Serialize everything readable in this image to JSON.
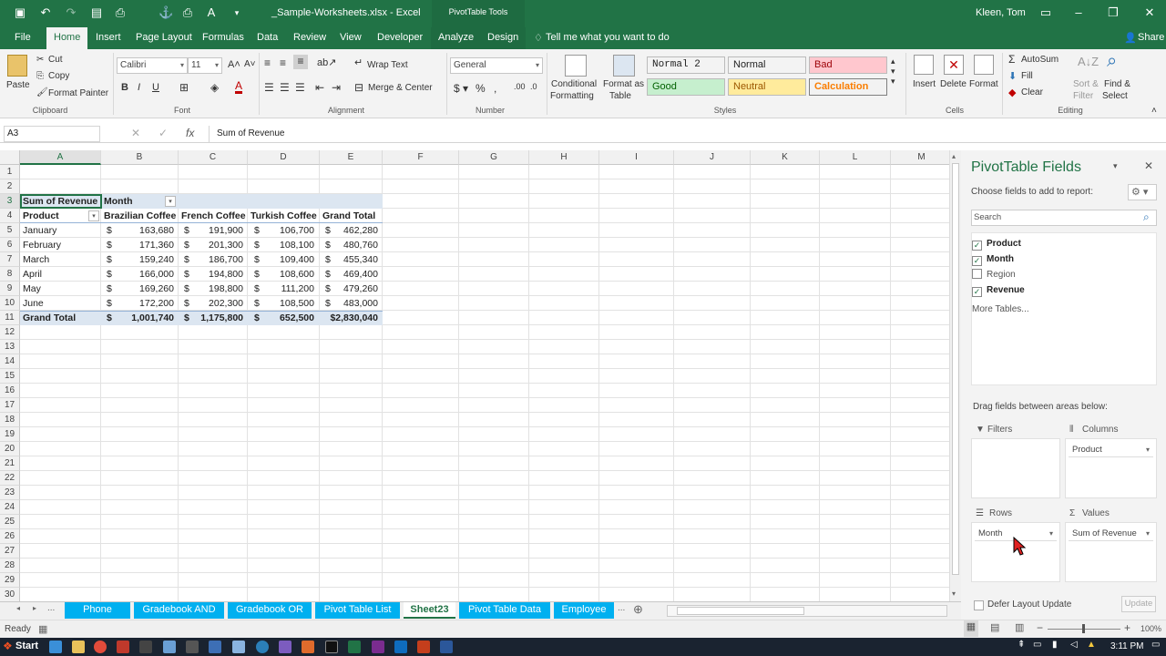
{
  "window": {
    "title": "_Sample-Worksheets.xlsx  -  Excel",
    "context_tab": "PivotTable Tools",
    "user": "Kleen, Tom",
    "share": "Share"
  },
  "tabs": [
    "File",
    "Home",
    "Insert",
    "Page Layout",
    "Formulas",
    "Data",
    "Review",
    "View",
    "Developer",
    "Analyze",
    "Design"
  ],
  "tell_me": "Tell me what you want to do",
  "ribbon": {
    "clipboard": {
      "label": "Clipboard",
      "paste": "Paste",
      "cut": "Cut",
      "copy": "Copy",
      "format_painter": "Format Painter"
    },
    "font": {
      "label": "Font",
      "name": "Calibri",
      "size": "11"
    },
    "alignment": {
      "label": "Alignment",
      "wrap": "Wrap Text",
      "merge": "Merge & Center"
    },
    "number": {
      "label": "Number",
      "format": "General"
    },
    "styles": {
      "label": "Styles",
      "conditional": "Conditional",
      "formatting": "Formatting",
      "format_as": "Format as",
      "table": "Table",
      "items": [
        {
          "name": "Normal 2",
          "bg": "#ffffff",
          "fg": "#333333"
        },
        {
          "name": "Normal",
          "bg": "#ffffff",
          "fg": "#000000"
        },
        {
          "name": "Bad",
          "bg": "#ffc7ce",
          "fg": "#9c0006"
        },
        {
          "name": "Good",
          "bg": "#c6efce",
          "fg": "#006100"
        },
        {
          "name": "Neutral",
          "bg": "#ffeb9c",
          "fg": "#9c5700"
        },
        {
          "name": "Calculation",
          "bg": "#f2f2f2",
          "fg": "#fa7d00"
        }
      ]
    },
    "cells": {
      "label": "Cells",
      "insert": "Insert",
      "delete": "Delete",
      "format": "Format"
    },
    "editing": {
      "label": "Editing",
      "autosum": "AutoSum",
      "fill": "Fill",
      "clear": "Clear",
      "sort": "Sort &",
      "filter": "Filter",
      "find": "Find &",
      "select": "Select"
    }
  },
  "formula_bar": {
    "name_box": "A3",
    "formula": "Sum of Revenue"
  },
  "columns": [
    "A",
    "B",
    "C",
    "D",
    "E",
    "F",
    "G",
    "H",
    "I",
    "J",
    "K",
    "L",
    "M"
  ],
  "rows": [
    "1",
    "2",
    "3",
    "4",
    "5",
    "6",
    "7",
    "8",
    "9",
    "10",
    "11",
    "12",
    "13",
    "14",
    "15",
    "16",
    "17",
    "18",
    "19",
    "20",
    "21",
    "22",
    "23",
    "24",
    "25",
    "26",
    "27",
    "28",
    "29",
    "30"
  ],
  "pivot": {
    "corner": "Sum of Revenue",
    "col_label": "Month",
    "row_label": "Product",
    "headers": [
      "Brazilian Coffee",
      "French Coffee",
      "Turkish Coffee",
      "Grand Total"
    ],
    "currency": "$",
    "data": [
      {
        "label": "January",
        "values": [
          "163,680",
          "191,900",
          "106,700",
          "462,280"
        ]
      },
      {
        "label": "February",
        "values": [
          "171,360",
          "201,300",
          "108,100",
          "480,760"
        ]
      },
      {
        "label": "March",
        "values": [
          "159,240",
          "186,700",
          "109,400",
          "455,340"
        ]
      },
      {
        "label": "April",
        "values": [
          "166,000",
          "194,800",
          "108,600",
          "469,400"
        ]
      },
      {
        "label": "May",
        "values": [
          "169,260",
          "198,800",
          "111,200",
          "479,260"
        ]
      },
      {
        "label": "June",
        "values": [
          "172,200",
          "202,300",
          "108,500",
          "483,000"
        ]
      }
    ],
    "total": {
      "label": "Grand Total",
      "values": [
        "1,001,740",
        "1,175,800",
        "652,500",
        "$2,830,040"
      ]
    }
  },
  "pane": {
    "title": "PivotTable Fields",
    "subtitle": "Choose fields to add to report:",
    "search_placeholder": "Search",
    "fields": [
      {
        "name": "Product",
        "checked": true
      },
      {
        "name": "Month",
        "checked": true
      },
      {
        "name": "Region",
        "checked": false
      },
      {
        "name": "Revenue",
        "checked": true
      }
    ],
    "more": "More Tables...",
    "drag": "Drag fields between areas below:",
    "filters": "Filters",
    "columns": "Columns",
    "rows": "Rows",
    "values": "Values",
    "columns_item": "Product",
    "rows_item": "Month",
    "values_item": "Sum of Revenue",
    "defer": "Defer Layout Update",
    "update": "Update"
  },
  "sheets": [
    "Phone Calls",
    "Gradebook AND",
    "Gradebook OR",
    "Pivot Table List",
    "Sheet23",
    "Pivot Table Data",
    "Employee E"
  ],
  "status": {
    "ready": "Ready",
    "zoom": "100%"
  },
  "taskbar": {
    "start": "Start",
    "time": "3:11 PM"
  }
}
